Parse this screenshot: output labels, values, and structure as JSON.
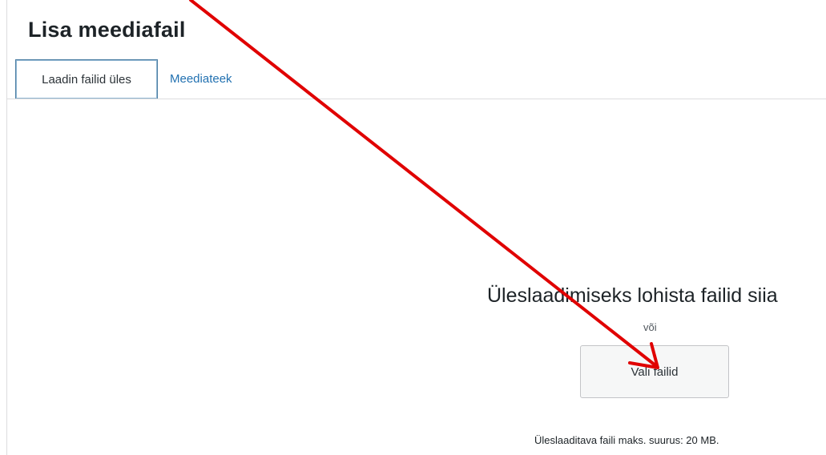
{
  "modal": {
    "title": "Lisa meediafail",
    "tabs": [
      {
        "label": "Laadin failid üles",
        "active": true
      },
      {
        "label": "Meediateek",
        "active": false
      }
    ]
  },
  "uploader": {
    "drop_instructions": "Üleslaadimiseks lohista failid siia",
    "or_text": "või",
    "select_button_label": "Vali failid",
    "max_size_text": "Üleslaaditava faili maks. suurus: 20 MB."
  },
  "annotation": {
    "arrow_color": "#e00000"
  },
  "colors": {
    "active_tab_border": "#4c7ea3",
    "link": "#2271b1"
  }
}
